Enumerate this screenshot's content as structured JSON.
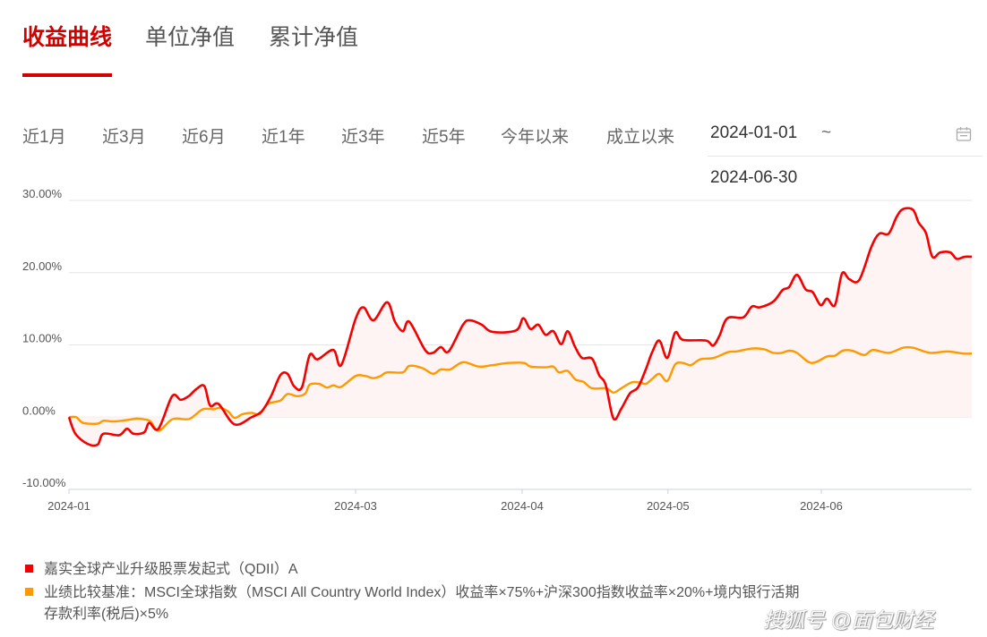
{
  "tabs": [
    {
      "label": "收益曲线",
      "active": true
    },
    {
      "label": "单位净值"
    },
    {
      "label": "累计净值"
    }
  ],
  "ranges": [
    "近1月",
    "近3月",
    "近6月",
    "近1年",
    "近3年",
    "近5年",
    "今年以来",
    "成立以来"
  ],
  "date_range": {
    "start": "2024-01-01",
    "separator": "~",
    "end": "2024-06-30"
  },
  "watermark": "搜狐号 @面包财经",
  "colors": {
    "accent": "#d40000",
    "fund": "#f40000",
    "benchmark": "#ff9900",
    "fill": "#fff4f4"
  },
  "chart_data": {
    "type": "line",
    "xlabel": "",
    "ylabel": "",
    "ylim": [
      -10,
      30
    ],
    "xlim": [
      0,
      126
    ],
    "x_unit": "trading day index",
    "yticks": [
      {
        "v": 30,
        "label": "30.00%"
      },
      {
        "v": 20,
        "label": "20.00%"
      },
      {
        "v": 10,
        "label": "10.00%"
      },
      {
        "v": 0,
        "label": "0.00%"
      },
      {
        "v": -10,
        "label": "-10.00%"
      }
    ],
    "xticks": [
      {
        "v": 0,
        "label": "2024-01"
      },
      {
        "v": 40,
        "label": "2024-03"
      },
      {
        "v": 63.25,
        "label": "2024-04"
      },
      {
        "v": 83.6,
        "label": "2024-05"
      },
      {
        "v": 105,
        "label": "2024-06"
      }
    ],
    "grid": true,
    "legend_position": "bottom-left",
    "series": [
      {
        "name": "嘉实全球产业升级股票发起式（QDII）A",
        "color": "#f40000",
        "fill": true,
        "points": [
          [
            0,
            0
          ],
          [
            0.9,
            -2.3
          ],
          [
            2.6,
            -3.7
          ],
          [
            4,
            -3.8
          ],
          [
            4.8,
            -2.3
          ],
          [
            7,
            -2.5
          ],
          [
            8.1,
            -1.6
          ],
          [
            9,
            -2.3
          ],
          [
            10.5,
            -2.1
          ],
          [
            11.2,
            -0.8
          ],
          [
            12.5,
            -1.6
          ],
          [
            14.4,
            2.9
          ],
          [
            15.6,
            2.4
          ],
          [
            16.7,
            2.9
          ],
          [
            17.8,
            3.9
          ],
          [
            18.9,
            4.3
          ],
          [
            19.7,
            1.6
          ],
          [
            20.9,
            1.8
          ],
          [
            23.1,
            -1.0
          ],
          [
            25.5,
            0
          ],
          [
            26.9,
            0.8
          ],
          [
            28.2,
            2.9
          ],
          [
            29.5,
            5.8
          ],
          [
            30.5,
            6.0
          ],
          [
            31.4,
            4.3
          ],
          [
            32.5,
            4.1
          ],
          [
            33.6,
            8.6
          ],
          [
            34.7,
            8.0
          ],
          [
            36.9,
            9.3
          ],
          [
            38,
            7.2
          ],
          [
            40,
            13.6
          ],
          [
            41.1,
            15.2
          ],
          [
            42.5,
            13.4
          ],
          [
            44.4,
            15.9
          ],
          [
            45.5,
            13.2
          ],
          [
            46.6,
            11.9
          ],
          [
            47.5,
            13.2
          ],
          [
            49.7,
            9.3
          ],
          [
            50.8,
            8.9
          ],
          [
            51.9,
            9.7
          ],
          [
            53,
            9.1
          ],
          [
            55,
            12.8
          ],
          [
            56,
            13.4
          ],
          [
            57.6,
            12.8
          ],
          [
            59.1,
            11.8
          ],
          [
            62.4,
            12.0
          ],
          [
            63.4,
            13.7
          ],
          [
            64.4,
            12.2
          ],
          [
            65.5,
            12.8
          ],
          [
            66.5,
            11.4
          ],
          [
            67.6,
            11.9
          ],
          [
            68.7,
            10.1
          ],
          [
            69.6,
            11.9
          ],
          [
            70.6,
            9.8
          ],
          [
            71.6,
            8.2
          ],
          [
            73,
            8.1
          ],
          [
            74,
            5.8
          ],
          [
            74.9,
            4.5
          ],
          [
            76,
            -0.2
          ],
          [
            77.1,
            1.2
          ],
          [
            78.3,
            3.3
          ],
          [
            79.4,
            4.1
          ],
          [
            80.5,
            6.6
          ],
          [
            81.4,
            9.0
          ],
          [
            82.4,
            10.6
          ],
          [
            83.5,
            8.2
          ],
          [
            84.6,
            11.7
          ],
          [
            85.7,
            10.7
          ],
          [
            88.9,
            10.6
          ],
          [
            89.9,
            9.9
          ],
          [
            90.8,
            11.3
          ],
          [
            91.9,
            13.7
          ],
          [
            94.1,
            13.8
          ],
          [
            95.3,
            15.3
          ],
          [
            96.4,
            15.2
          ],
          [
            98.3,
            16.0
          ],
          [
            99.6,
            17.6
          ],
          [
            100.5,
            18.0
          ],
          [
            101.6,
            19.7
          ],
          [
            102.8,
            17.7
          ],
          [
            103.8,
            17.3
          ],
          [
            104.9,
            15.5
          ],
          [
            105.8,
            16.4
          ],
          [
            106.9,
            15.5
          ],
          [
            107.9,
            19.9
          ],
          [
            108.9,
            19.1
          ],
          [
            110.3,
            19.0
          ],
          [
            112,
            23.6
          ],
          [
            113.1,
            25.4
          ],
          [
            114.4,
            25.4
          ],
          [
            115.5,
            27.7
          ],
          [
            116.4,
            28.8
          ],
          [
            117.8,
            28.7
          ],
          [
            118.6,
            26.9
          ],
          [
            119.6,
            25.5
          ],
          [
            120.5,
            22.2
          ],
          [
            121.6,
            22.8
          ],
          [
            123,
            22.8
          ],
          [
            123.9,
            21.9
          ],
          [
            125,
            22.2
          ],
          [
            126,
            22.2
          ]
        ]
      },
      {
        "name": "业绩比较基准：MSCI全球指数（MSCI All Country World Index）收益率×75%+沪深300指数收益率×20%+境内银行活期存款利率(税后)×5%",
        "color": "#ff9900",
        "fill": false,
        "points": [
          [
            0,
            0
          ],
          [
            1,
            0
          ],
          [
            2,
            -0.8
          ],
          [
            4,
            -0.9
          ],
          [
            4.8,
            -0.5
          ],
          [
            6.2,
            -0.6
          ],
          [
            8.1,
            -0.4
          ],
          [
            9.4,
            -0.2
          ],
          [
            10.5,
            -0.3
          ],
          [
            11.4,
            -0.6
          ],
          [
            12.5,
            -1.9
          ],
          [
            14.4,
            -0.3
          ],
          [
            16.3,
            -0.3
          ],
          [
            17.1,
            -0.1
          ],
          [
            18.7,
            1.1
          ],
          [
            20.2,
            1.1
          ],
          [
            21.1,
            1.3
          ],
          [
            22.2,
            0.8
          ],
          [
            23.1,
            -0.1
          ],
          [
            24.2,
            0.4
          ],
          [
            25.5,
            0.6
          ],
          [
            26.6,
            0.4
          ],
          [
            27.7,
            1.8
          ],
          [
            29.5,
            2.3
          ],
          [
            30.5,
            3.2
          ],
          [
            31.9,
            2.9
          ],
          [
            33,
            3.3
          ],
          [
            33.6,
            4.5
          ],
          [
            34.9,
            4.6
          ],
          [
            36,
            4.1
          ],
          [
            36.9,
            4.4
          ],
          [
            38,
            4.2
          ],
          [
            40,
            5.7
          ],
          [
            41.3,
            5.7
          ],
          [
            42.5,
            5.4
          ],
          [
            43.5,
            5.7
          ],
          [
            44.4,
            6.2
          ],
          [
            46.6,
            6.2
          ],
          [
            47.5,
            7.1
          ],
          [
            49.3,
            6.8
          ],
          [
            50.8,
            6.0
          ],
          [
            51.9,
            6.6
          ],
          [
            53.2,
            6.6
          ],
          [
            55,
            7.6
          ],
          [
            57.2,
            7.0
          ],
          [
            59.1,
            7.2
          ],
          [
            61.3,
            7.5
          ],
          [
            63.5,
            7.5
          ],
          [
            64.4,
            7.0
          ],
          [
            66.5,
            6.9
          ],
          [
            67.6,
            7.0
          ],
          [
            68.4,
            6.2
          ],
          [
            69.6,
            6.4
          ],
          [
            70.7,
            5.2
          ],
          [
            71.8,
            4.9
          ],
          [
            73,
            4.0
          ],
          [
            75,
            4.0
          ],
          [
            76,
            3.4
          ],
          [
            77.1,
            4.0
          ],
          [
            78.5,
            4.8
          ],
          [
            79.6,
            4.8
          ],
          [
            80.5,
            4.6
          ],
          [
            81.4,
            5.3
          ],
          [
            82.4,
            6.0
          ],
          [
            83.5,
            5.0
          ],
          [
            84.6,
            7.3
          ],
          [
            85.7,
            7.5
          ],
          [
            86.8,
            7.2
          ],
          [
            88.1,
            8.0
          ],
          [
            90,
            8.2
          ],
          [
            92,
            9.0
          ],
          [
            93.2,
            9.1
          ],
          [
            95.3,
            9.5
          ],
          [
            97,
            9.4
          ],
          [
            98.3,
            8.9
          ],
          [
            99.5,
            8.9
          ],
          [
            100.5,
            9.2
          ],
          [
            101.6,
            8.9
          ],
          [
            103.6,
            7.5
          ],
          [
            105.8,
            8.4
          ],
          [
            106.9,
            8.5
          ],
          [
            108,
            9.2
          ],
          [
            109.3,
            9.2
          ],
          [
            111,
            8.6
          ],
          [
            112.2,
            9.3
          ],
          [
            114.4,
            8.9
          ],
          [
            116.4,
            9.6
          ],
          [
            117.8,
            9.6
          ],
          [
            120.2,
            8.9
          ],
          [
            122.6,
            9.1
          ],
          [
            124.8,
            8.8
          ],
          [
            126,
            8.8
          ]
        ]
      }
    ]
  },
  "legend": {
    "line1": "嘉实全球产业升级股票发起式（QDII）A",
    "line2": "业绩比较基准：MSCI全球指数（MSCI All Country World Index）收益率×75%+沪深300指数收益率×20%+境内银行活期",
    "line3": "存款利率(税后)×5%"
  }
}
